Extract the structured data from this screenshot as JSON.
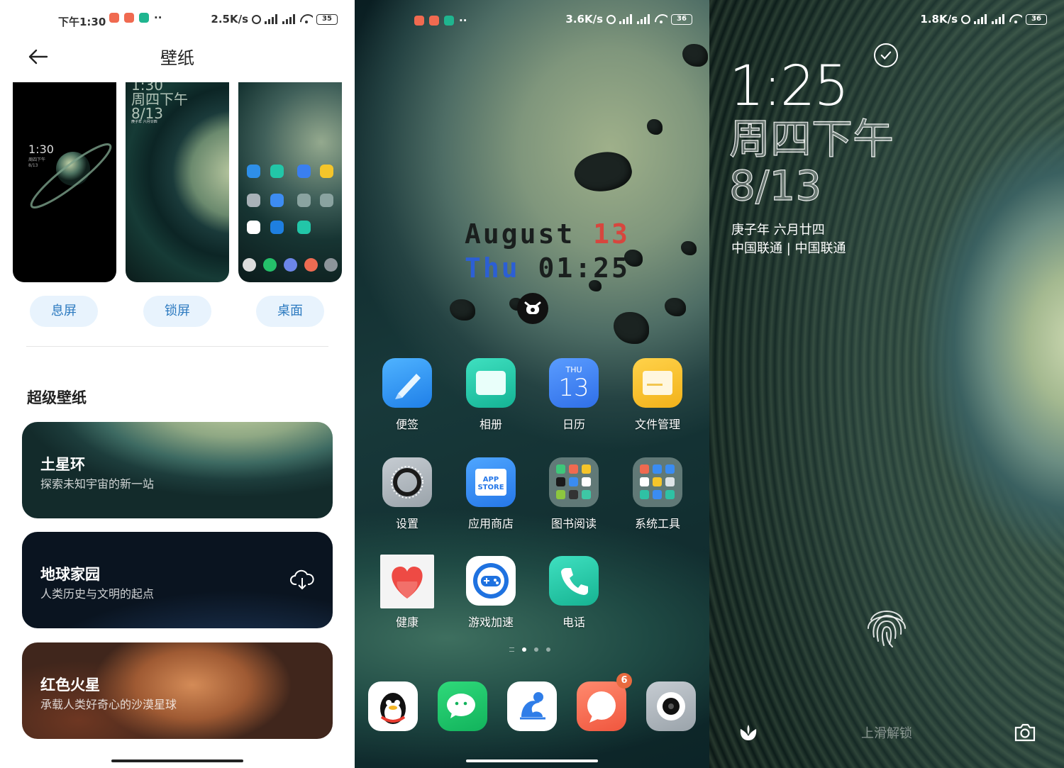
{
  "panel1": {
    "status": {
      "time": "下午1:30",
      "speed": "2.5K/s",
      "battery": "35",
      "more": "··"
    },
    "title": "壁纸",
    "previews": {
      "aod_time": "1:30",
      "aod_sub": "周四下午\n8/13",
      "lock_time": "1:30",
      "lock_day": "周四下午",
      "lock_date": "8/13",
      "lock_sub": "庚子年 六月廿四"
    },
    "tabs": [
      "息屏",
      "锁屏",
      "桌面"
    ],
    "section_title": "超级壁纸",
    "cards": [
      {
        "name": "土星环",
        "desc": "探索未知宇宙的新一站"
      },
      {
        "name": "地球家园",
        "desc": "人类历史与文明的起点"
      },
      {
        "name": "红色火星",
        "desc": "承载人类好奇心的沙漠星球"
      }
    ]
  },
  "panel2": {
    "status": {
      "speed": "3.6K/s",
      "battery": "36",
      "more": "··"
    },
    "date_line1_a": "August ",
    "date_line1_b": "13",
    "date_line2_a": "Thu ",
    "date_line2_b": "01:25",
    "calendar": {
      "day": "THU",
      "date": "13"
    },
    "appstore_text": [
      "APP",
      "STORE"
    ],
    "apps": [
      {
        "label": "便签"
      },
      {
        "label": "相册"
      },
      {
        "label": "日历"
      },
      {
        "label": "文件管理"
      },
      {
        "label": "设置"
      },
      {
        "label": "应用商店"
      },
      {
        "label": "图书阅读"
      },
      {
        "label": "系统工具"
      },
      {
        "label": "健康"
      },
      {
        "label": "游戏加速"
      },
      {
        "label": "电话"
      }
    ],
    "dock_badge": "6"
  },
  "panel3": {
    "status": {
      "speed": "1.8K/s",
      "battery": "36"
    },
    "time": "1:25",
    "day": "周四下午",
    "date": "8/13",
    "lunar": "庚子年 六月廿四",
    "carrier": "中国联通 | 中国联通",
    "swipe": "上滑解锁"
  },
  "colors": {
    "accent_blue": "#2c7ac0",
    "pill_bg": "#e8f3fd",
    "date_red": "#d7463e",
    "date_blue": "#2c5fd4",
    "badge_orange": "#e86a3f"
  }
}
